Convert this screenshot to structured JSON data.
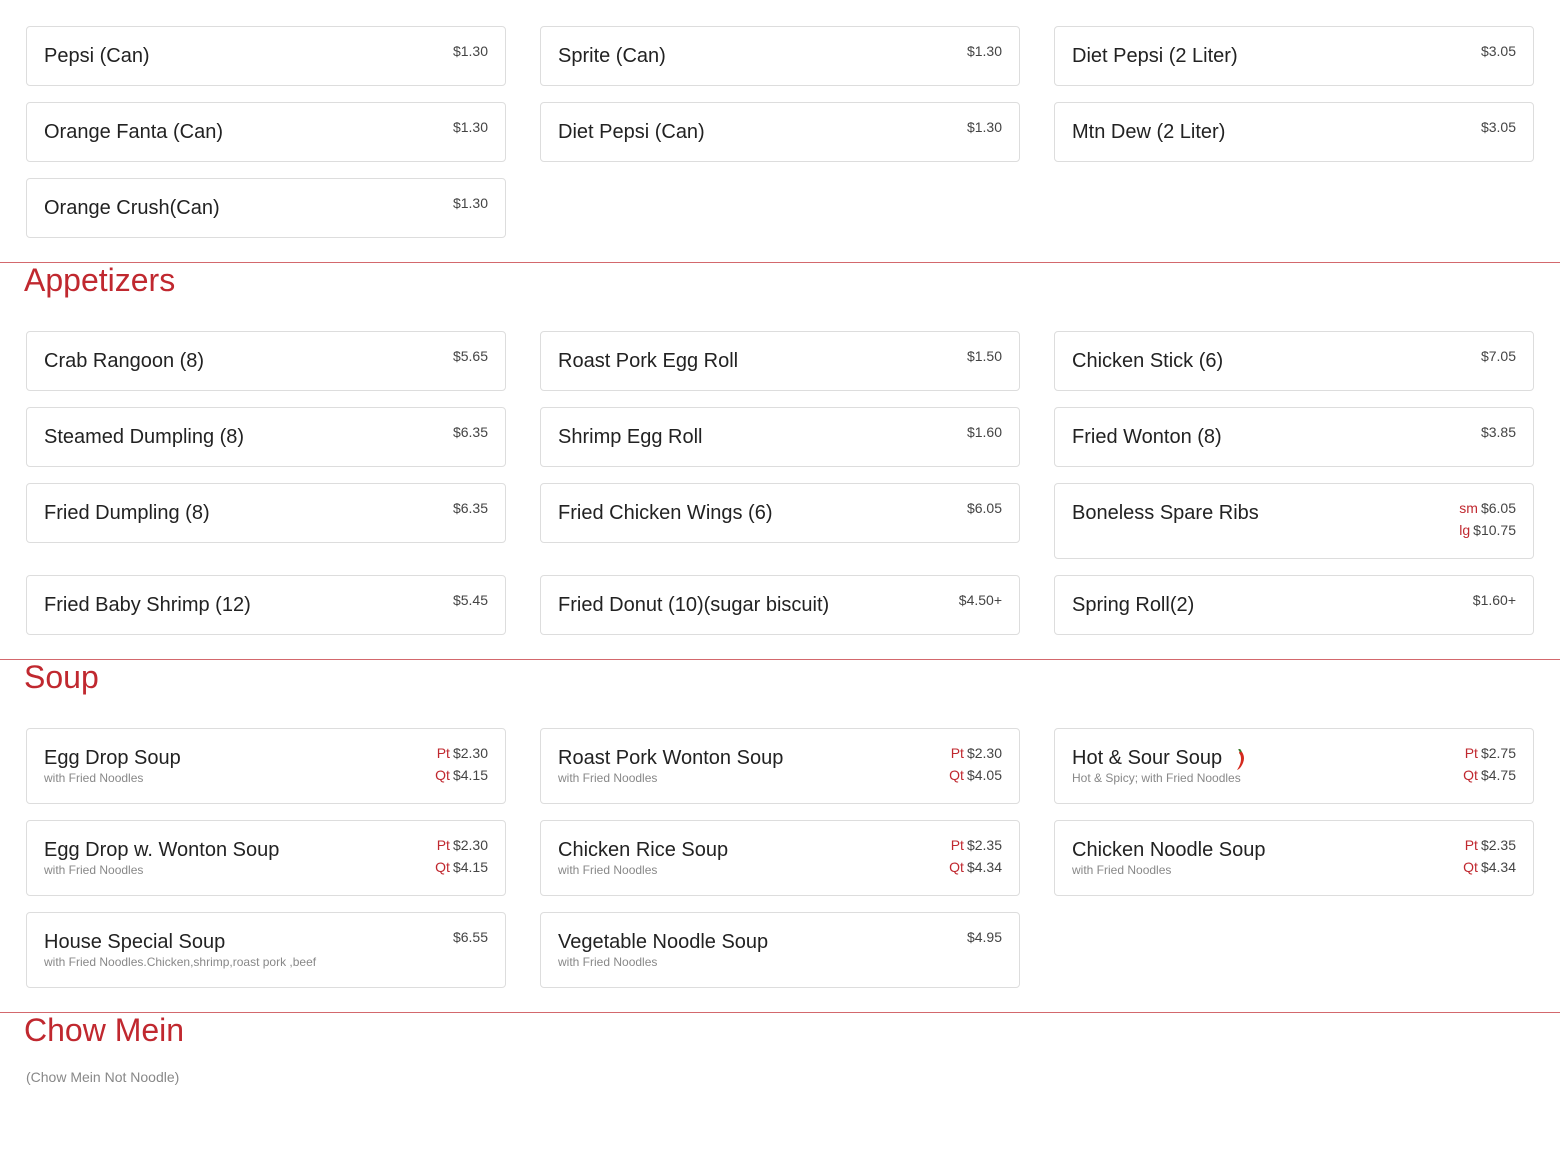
{
  "sections": [
    {
      "title": null,
      "items": [
        {
          "name": "Pepsi (Can)",
          "prices": [
            {
              "price": "$1.30"
            }
          ]
        },
        {
          "name": "Sprite (Can)",
          "prices": [
            {
              "price": "$1.30"
            }
          ]
        },
        {
          "name": "Diet Pepsi (2 Liter)",
          "prices": [
            {
              "price": "$3.05"
            }
          ]
        },
        {
          "name": "Orange Fanta (Can)",
          "prices": [
            {
              "price": "$1.30"
            }
          ]
        },
        {
          "name": "Diet Pepsi (Can)",
          "prices": [
            {
              "price": "$1.30"
            }
          ]
        },
        {
          "name": "Mtn Dew (2 Liter)",
          "prices": [
            {
              "price": "$3.05"
            }
          ]
        },
        {
          "name": "Orange Crush(Can)",
          "prices": [
            {
              "price": "$1.30"
            }
          ]
        }
      ]
    },
    {
      "title": "Appetizers",
      "items": [
        {
          "name": "Crab Rangoon (8)",
          "prices": [
            {
              "price": "$5.65"
            }
          ]
        },
        {
          "name": "Roast Pork Egg Roll",
          "prices": [
            {
              "price": "$1.50"
            }
          ]
        },
        {
          "name": "Chicken Stick (6)",
          "prices": [
            {
              "price": "$7.05"
            }
          ]
        },
        {
          "name": "Steamed Dumpling (8)",
          "prices": [
            {
              "price": "$6.35"
            }
          ]
        },
        {
          "name": "Shrimp Egg Roll",
          "prices": [
            {
              "price": "$1.60"
            }
          ]
        },
        {
          "name": "Fried Wonton (8)",
          "prices": [
            {
              "price": "$3.85"
            }
          ]
        },
        {
          "name": "Fried Dumpling (8)",
          "prices": [
            {
              "price": "$6.35"
            }
          ]
        },
        {
          "name": "Fried Chicken Wings (6)",
          "prices": [
            {
              "price": "$6.05"
            }
          ]
        },
        {
          "name": "Boneless Spare Ribs",
          "prices": [
            {
              "label": "sm",
              "price": "$6.05"
            },
            {
              "label": "lg",
              "price": "$10.75"
            }
          ]
        },
        {
          "name": "Fried Baby Shrimp (12)",
          "prices": [
            {
              "price": "$5.45"
            }
          ]
        },
        {
          "name": "Fried Donut (10)(sugar biscuit)",
          "prices": [
            {
              "price": "$4.50+"
            }
          ]
        },
        {
          "name": "Spring Roll(2)",
          "prices": [
            {
              "price": "$1.60+"
            }
          ]
        }
      ]
    },
    {
      "title": "Soup",
      "items": [
        {
          "name": "Egg Drop Soup",
          "desc": "with Fried Noodles",
          "prices": [
            {
              "label": "Pt",
              "price": "$2.30"
            },
            {
              "label": "Qt",
              "price": "$4.15"
            }
          ]
        },
        {
          "name": "Roast Pork Wonton Soup",
          "desc": "with Fried Noodles",
          "prices": [
            {
              "label": "Pt",
              "price": "$2.30"
            },
            {
              "label": "Qt",
              "price": "$4.05"
            }
          ]
        },
        {
          "name": "Hot & Sour Soup",
          "spicy": true,
          "desc": "Hot & Spicy; with Fried Noodles",
          "prices": [
            {
              "label": "Pt",
              "price": "$2.75"
            },
            {
              "label": "Qt",
              "price": "$4.75"
            }
          ]
        },
        {
          "name": "Egg Drop w. Wonton Soup",
          "desc": "with Fried Noodles",
          "prices": [
            {
              "label": "Pt",
              "price": "$2.30"
            },
            {
              "label": "Qt",
              "price": "$4.15"
            }
          ]
        },
        {
          "name": "Chicken Rice Soup",
          "desc": "with Fried Noodles",
          "prices": [
            {
              "label": "Pt",
              "price": "$2.35"
            },
            {
              "label": "Qt",
              "price": "$4.34"
            }
          ]
        },
        {
          "name": "Chicken Noodle Soup",
          "desc": "with Fried Noodles",
          "prices": [
            {
              "label": "Pt",
              "price": "$2.35"
            },
            {
              "label": "Qt",
              "price": "$4.34"
            }
          ]
        },
        {
          "name": "House Special Soup",
          "desc": "with Fried Noodles.Chicken,shrimp,roast pork ,beef",
          "prices": [
            {
              "price": "$6.55"
            }
          ]
        },
        {
          "name": "Vegetable Noodle Soup",
          "desc": "with Fried Noodles",
          "prices": [
            {
              "price": "$4.95"
            }
          ]
        }
      ]
    },
    {
      "title": "Chow Mein",
      "subtitle": "(Chow Mein Not Noodle)",
      "items": []
    }
  ],
  "colors": {
    "accent": "#c0282f",
    "border": "#dddddd"
  },
  "icons": {
    "spicy": "chili-pepper-icon"
  }
}
